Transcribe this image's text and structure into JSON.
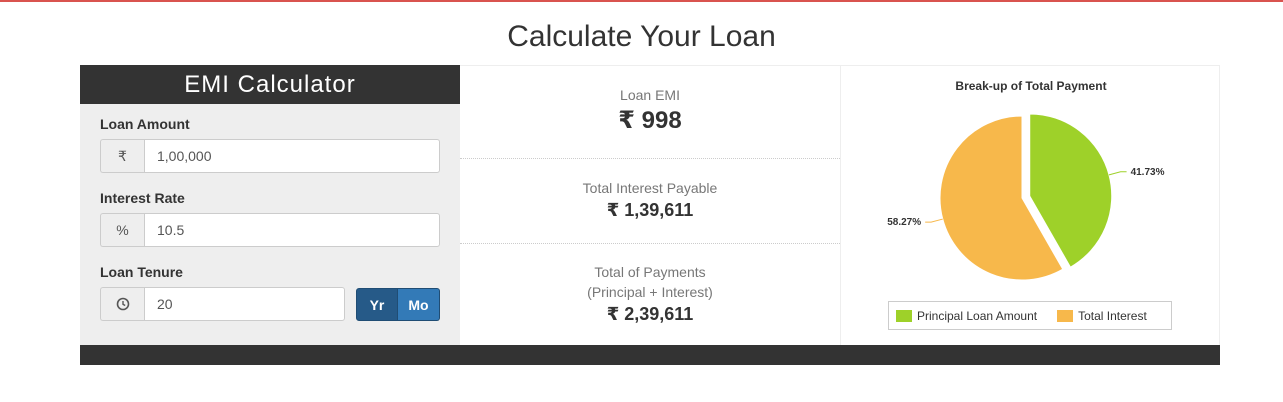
{
  "page": {
    "title": "Calculate Your Loan"
  },
  "colors": {
    "accent_top": "#d9534f",
    "principal": "#9ed129",
    "interest": "#f7b84b",
    "button_primary": "#337ab7",
    "header_bg": "#333333"
  },
  "calculator": {
    "header": "EMI Calculator",
    "loan_amount": {
      "label": "Loan Amount",
      "addon": "₹",
      "value": "1,00,000"
    },
    "interest_rate": {
      "label": "Interest Rate",
      "addon": "%",
      "value": "10.5"
    },
    "loan_tenure": {
      "label": "Loan Tenure",
      "addon_icon": "clock-icon",
      "value": "20",
      "buttons": [
        "Yr",
        "Mo"
      ],
      "selected": "Yr"
    }
  },
  "results": {
    "emi": {
      "label": "Loan EMI",
      "value": "₹ 998"
    },
    "total_interest": {
      "label": "Total Interest Payable",
      "value": "₹ 1,39,611"
    },
    "total_payment": {
      "label": "Total of Payments",
      "sublabel": "(Principal + Interest)",
      "value": "₹ 2,39,611"
    }
  },
  "chart_data": {
    "type": "pie",
    "title": "Break-up of Total Payment",
    "slices": [
      {
        "name": "Principal Loan Amount",
        "value": 41.73,
        "label": "41.73%",
        "color": "#9ed129"
      },
      {
        "name": "Total Interest",
        "value": 58.27,
        "label": "58.27%",
        "color": "#f7b84b"
      }
    ],
    "legend_position": "bottom"
  }
}
